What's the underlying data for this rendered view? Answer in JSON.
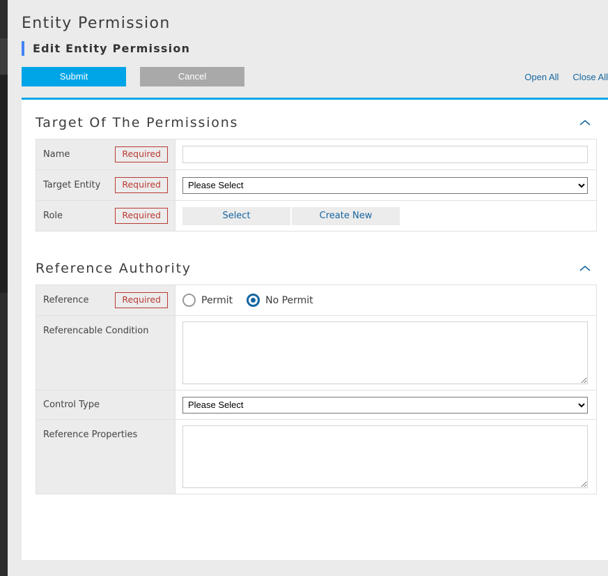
{
  "header": {
    "page_title": "Entity Permission",
    "subtitle": "Edit Entity Permission"
  },
  "toolbar": {
    "submit_label": "Submit",
    "cancel_label": "Cancel",
    "open_all_label": "Open All",
    "close_all_label": "Close All"
  },
  "sections": [
    {
      "title": "Target Of The Permissions",
      "collapse_icon": "chevron-up-icon",
      "rows": [
        {
          "label": "Name",
          "required_badge": "Required",
          "field_type": "text",
          "value": "",
          "placeholder": ""
        },
        {
          "label": "Target Entity",
          "required_badge": "Required",
          "field_type": "select",
          "value": "Please Select",
          "options": [
            "Please Select"
          ]
        },
        {
          "label": "Role",
          "required_badge": "Required",
          "field_type": "buttons",
          "buttons": [
            "Select",
            "Create New"
          ]
        }
      ]
    },
    {
      "title": "Reference Authority",
      "collapse_icon": "chevron-up-icon",
      "rows": [
        {
          "label": "Reference",
          "required_badge": "Required",
          "field_type": "radio",
          "options": [
            {
              "label": "Permit",
              "checked": false
            },
            {
              "label": "No Permit",
              "checked": true
            }
          ]
        },
        {
          "label": "Referencable Condition",
          "required_badge": "",
          "field_type": "textarea",
          "value": ""
        },
        {
          "label": "Control Type",
          "required_badge": "",
          "field_type": "select",
          "value": "Please Select",
          "options": [
            "Please Select"
          ]
        },
        {
          "label": "Reference Properties",
          "required_badge": "",
          "field_type": "textarea",
          "value": ""
        }
      ]
    }
  ],
  "colors": {
    "accent_blue": "#00a5e7",
    "link_blue": "#15659f",
    "subtitle_accent": "#4285f4",
    "required_red": "#b93a33",
    "cancel_gray": "#a9a9a9",
    "label_bg": "#ececec",
    "page_bg": "#ebebeb",
    "rail_dark": "#212121"
  }
}
